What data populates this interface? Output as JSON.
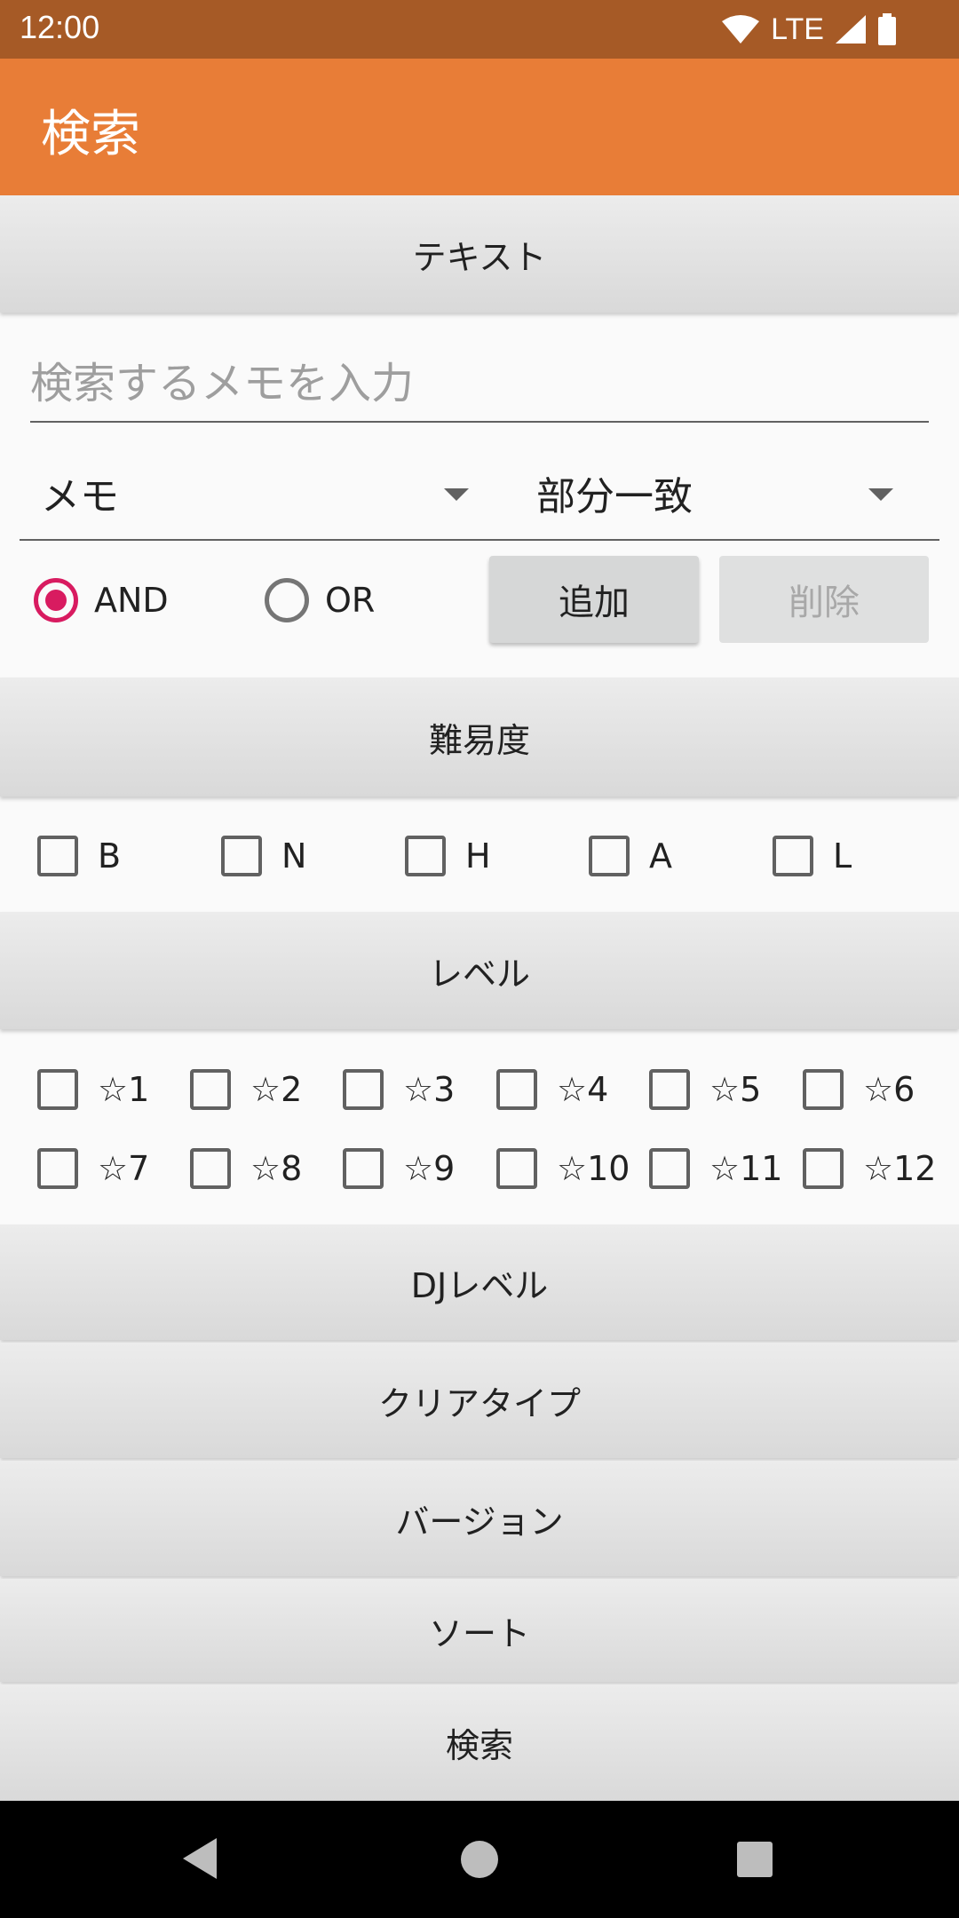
{
  "status_bar": {
    "time": "12:00",
    "network": "LTE"
  },
  "app_bar": {
    "title": "検索"
  },
  "sections": {
    "text": "テキスト",
    "difficulty": "難易度",
    "level": "レベル",
    "dj_level": "DJレベル",
    "clear_type": "クリアタイプ",
    "version": "バージョン",
    "sort": "ソート",
    "search": "検索"
  },
  "memo_input": {
    "placeholder": "検索するメモを入力",
    "value": ""
  },
  "target_spinner": {
    "selected": "メモ"
  },
  "match_spinner": {
    "selected": "部分一致"
  },
  "logic": {
    "and_label": "AND",
    "or_label": "OR",
    "selected": "AND"
  },
  "buttons": {
    "add": "追加",
    "delete": "削除"
  },
  "difficulty_options": [
    "B",
    "N",
    "H",
    "A",
    "L"
  ],
  "level_options": [
    "☆1",
    "☆2",
    "☆3",
    "☆4",
    "☆5",
    "☆6",
    "☆7",
    "☆8",
    "☆9",
    "☆10",
    "☆11",
    "☆12"
  ],
  "colors": {
    "primary": "#e87d37",
    "primary_dark": "#a65a26",
    "accent": "#d81b60"
  }
}
